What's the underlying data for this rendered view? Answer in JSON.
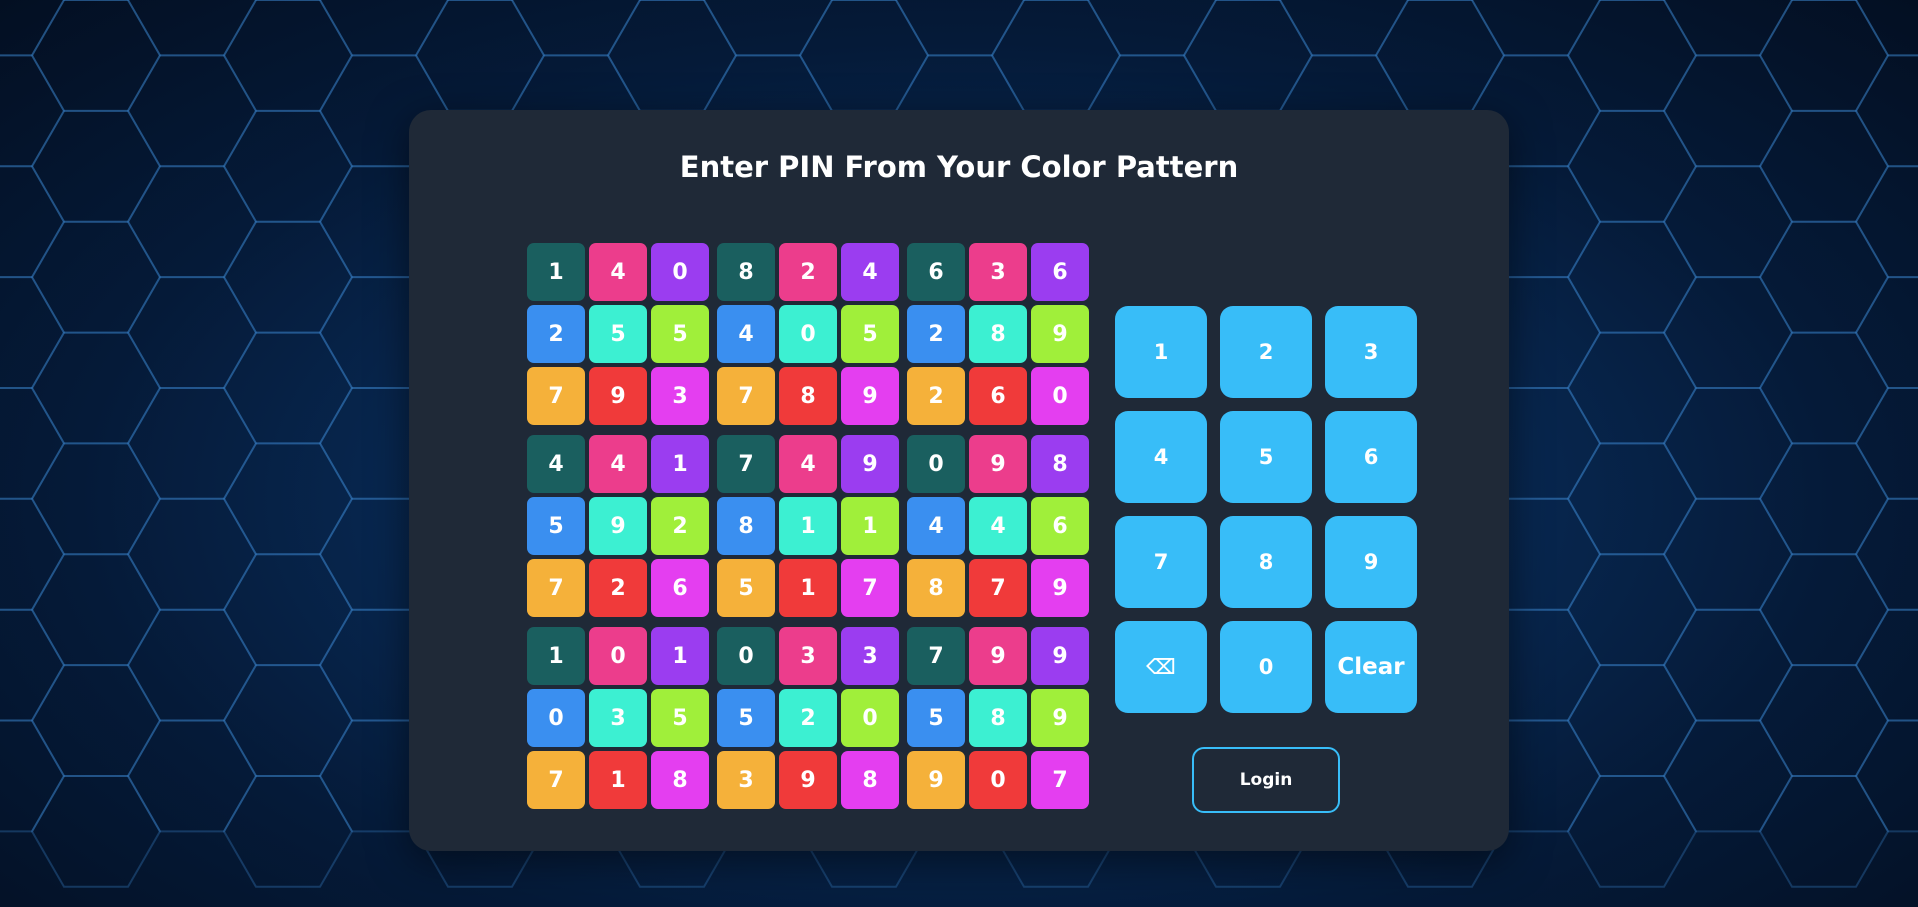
{
  "page": {
    "title": "Enter PIN From Your Color Pattern"
  },
  "colors": {
    "card": "#1f2937",
    "key": "#38bdf8",
    "row1": [
      "#1a5f5f",
      "#ec3d8c",
      "#9b3df0"
    ],
    "row2": [
      "#3a8ff0",
      "#3cf0d2",
      "#a0ef3a"
    ],
    "row3": [
      "#f5b13a",
      "#f03a3a",
      "#e43ef0"
    ]
  },
  "pattern": {
    "blocks": [
      [
        "1",
        "4",
        "0",
        "2",
        "5",
        "5",
        "7",
        "9",
        "3"
      ],
      [
        "8",
        "2",
        "4",
        "4",
        "0",
        "5",
        "7",
        "8",
        "9"
      ],
      [
        "6",
        "3",
        "6",
        "2",
        "8",
        "9",
        "2",
        "6",
        "0"
      ],
      [
        "4",
        "4",
        "1",
        "5",
        "9",
        "2",
        "7",
        "2",
        "6"
      ],
      [
        "7",
        "4",
        "9",
        "8",
        "1",
        "1",
        "5",
        "1",
        "7"
      ],
      [
        "0",
        "9",
        "8",
        "4",
        "4",
        "6",
        "8",
        "7",
        "9"
      ],
      [
        "1",
        "0",
        "1",
        "0",
        "3",
        "5",
        "7",
        "1",
        "8"
      ],
      [
        "0",
        "3",
        "3",
        "5",
        "2",
        "0",
        "3",
        "9",
        "8"
      ],
      [
        "7",
        "9",
        "9",
        "5",
        "8",
        "9",
        "9",
        "0",
        "7"
      ]
    ]
  },
  "keypad": {
    "keys": [
      {
        "label": "1",
        "name": "key-1"
      },
      {
        "label": "2",
        "name": "key-2"
      },
      {
        "label": "3",
        "name": "key-3"
      },
      {
        "label": "4",
        "name": "key-4"
      },
      {
        "label": "5",
        "name": "key-5"
      },
      {
        "label": "6",
        "name": "key-6"
      },
      {
        "label": "7",
        "name": "key-7"
      },
      {
        "label": "8",
        "name": "key-8"
      },
      {
        "label": "9",
        "name": "key-9"
      },
      {
        "label": "⌫",
        "name": "backspace-button"
      },
      {
        "label": "0",
        "name": "key-0"
      },
      {
        "label": "Clear",
        "name": "clear-button"
      }
    ]
  },
  "login": {
    "label": "Login"
  }
}
